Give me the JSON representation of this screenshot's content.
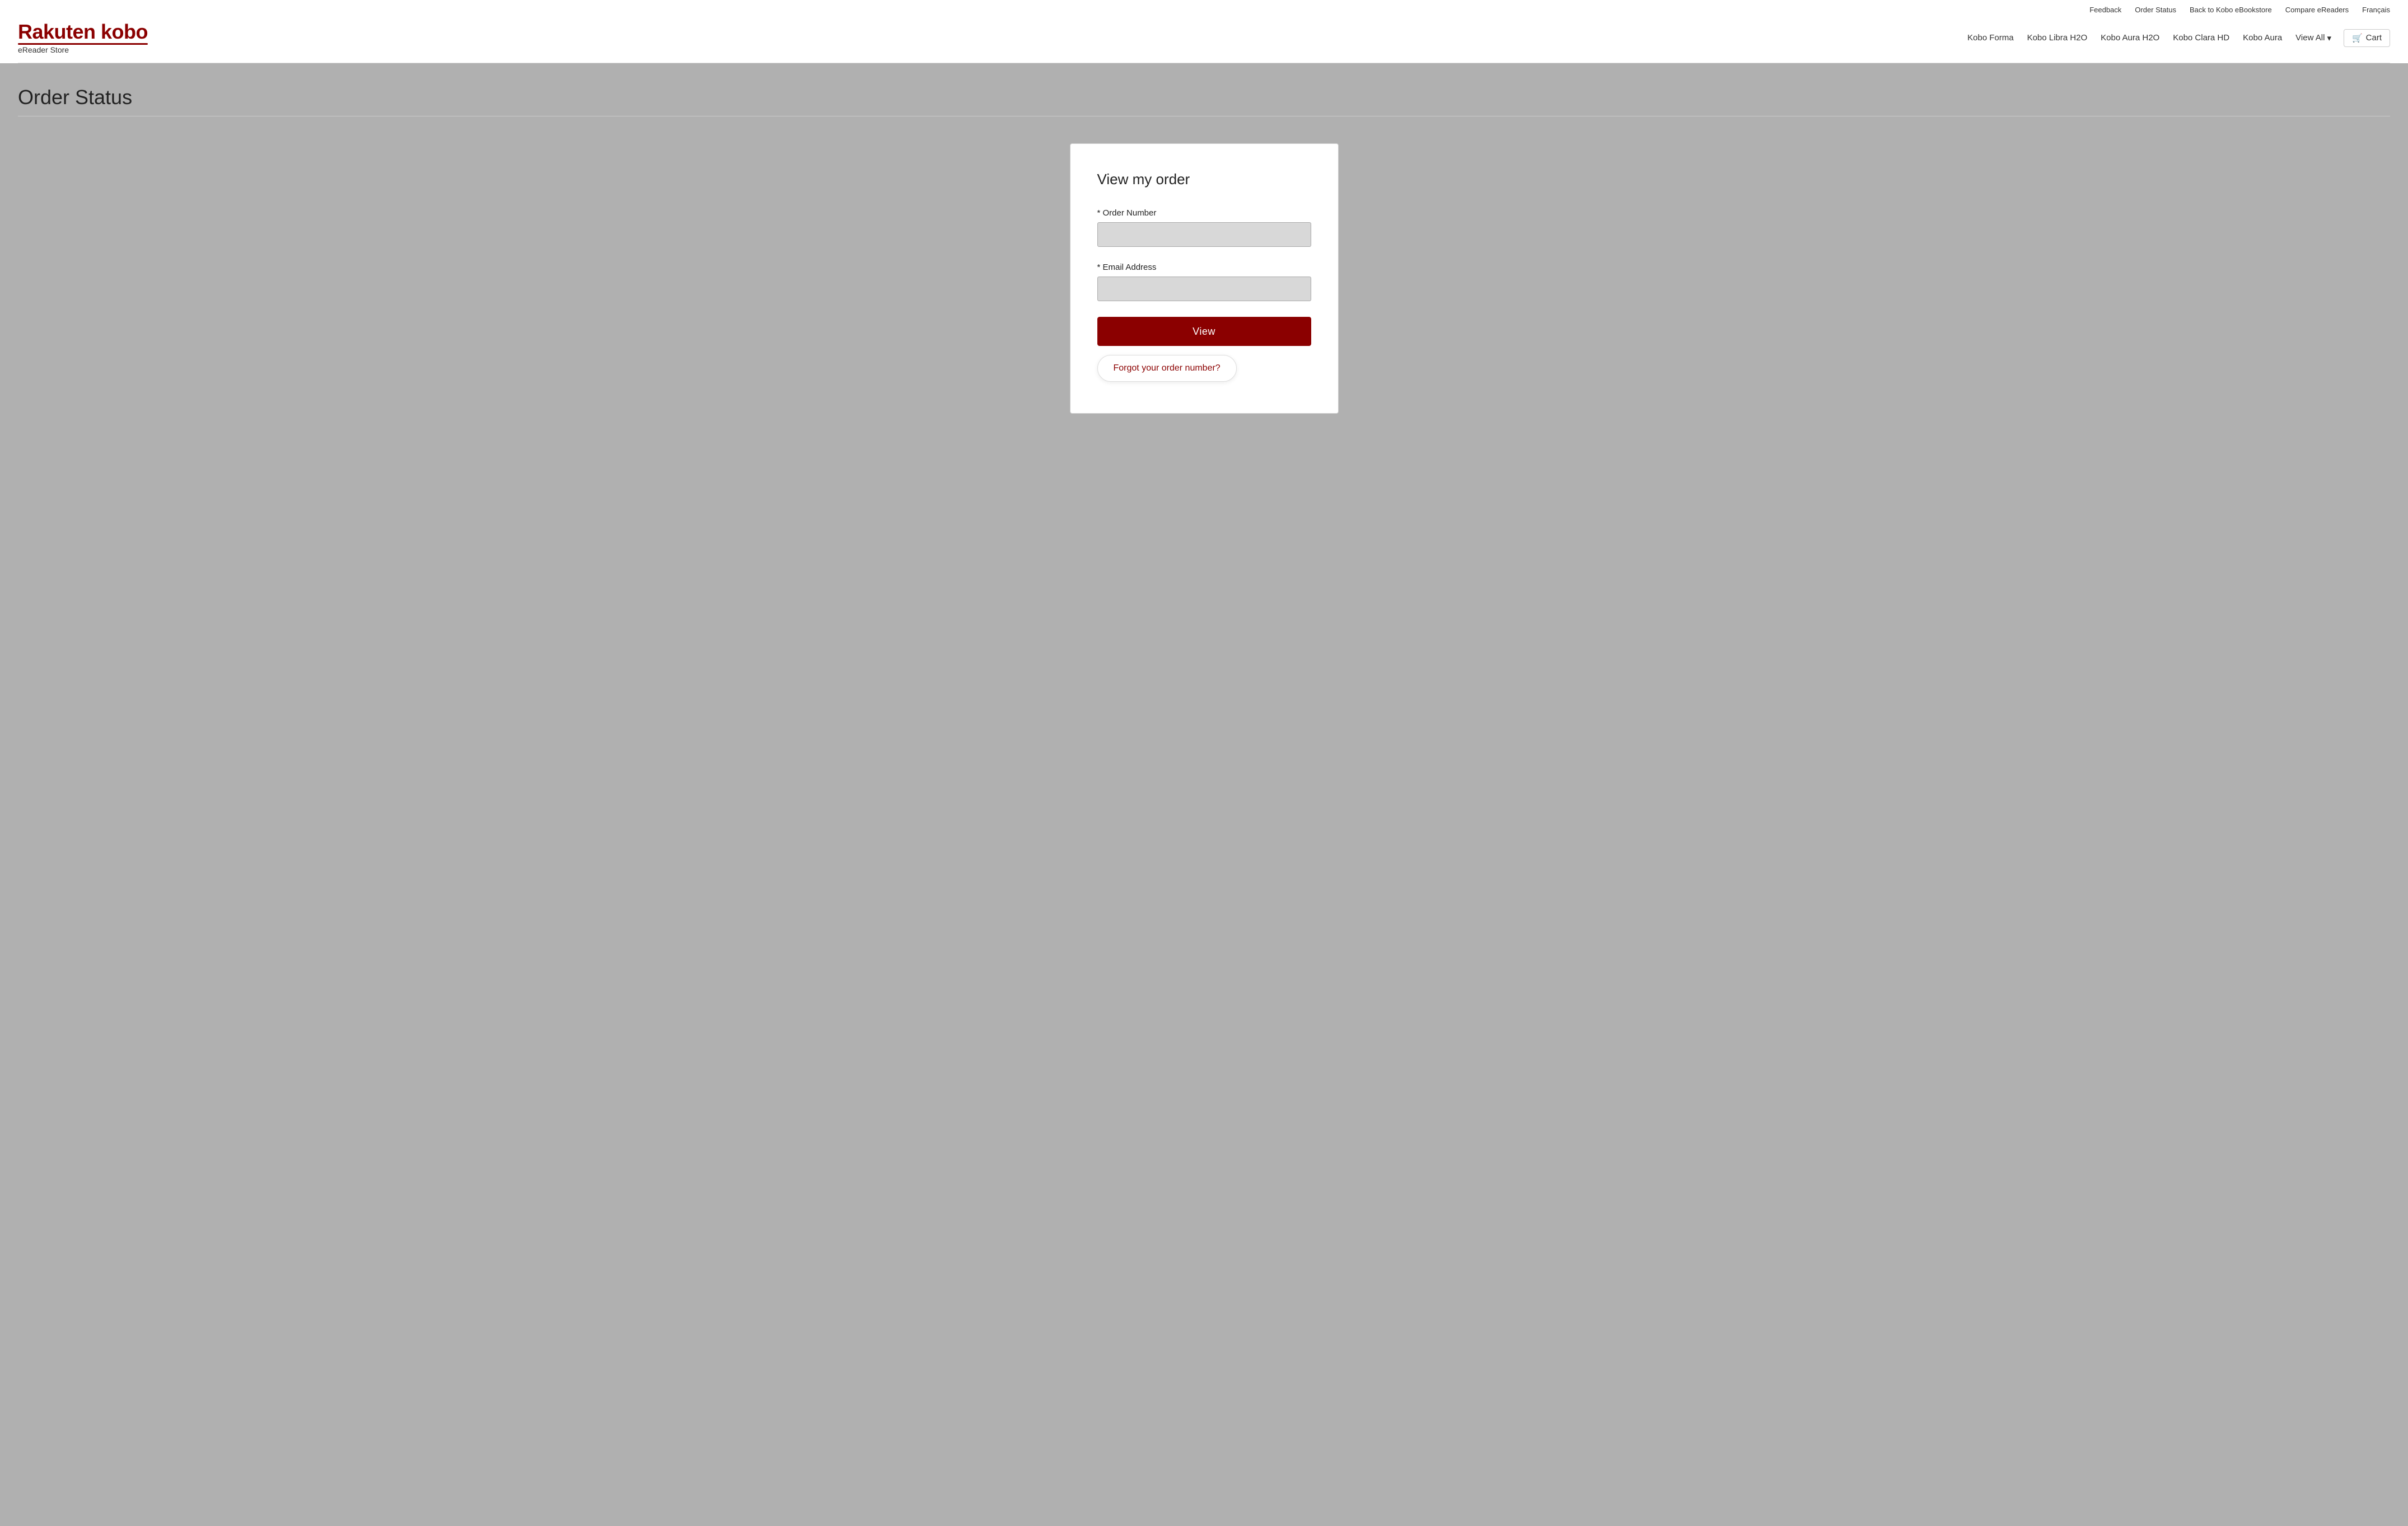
{
  "topNav": {
    "feedback": "Feedback",
    "orderStatus": "Order Status",
    "backToKobo": "Back to Kobo eBookstore",
    "compareEreaders": "Compare eReaders",
    "francais": "Français"
  },
  "logo": {
    "brand": "Rakuten kobo",
    "subtitle": "eReader Store"
  },
  "mainNav": {
    "items": [
      {
        "label": "Kobo Forma"
      },
      {
        "label": "Kobo Libra H2O"
      },
      {
        "label": "Kobo Aura H2O"
      },
      {
        "label": "Kobo Clara HD"
      },
      {
        "label": "Kobo Aura"
      },
      {
        "label": "View All"
      }
    ],
    "cart": "Cart"
  },
  "page": {
    "title": "Order Status"
  },
  "form": {
    "title": "View my order",
    "orderNumberLabel": "* Order Number",
    "orderNumberPlaceholder": "",
    "emailLabel": "* Email Address",
    "emailPlaceholder": "",
    "viewButton": "View",
    "forgotLink": "Forgot your order number?"
  }
}
